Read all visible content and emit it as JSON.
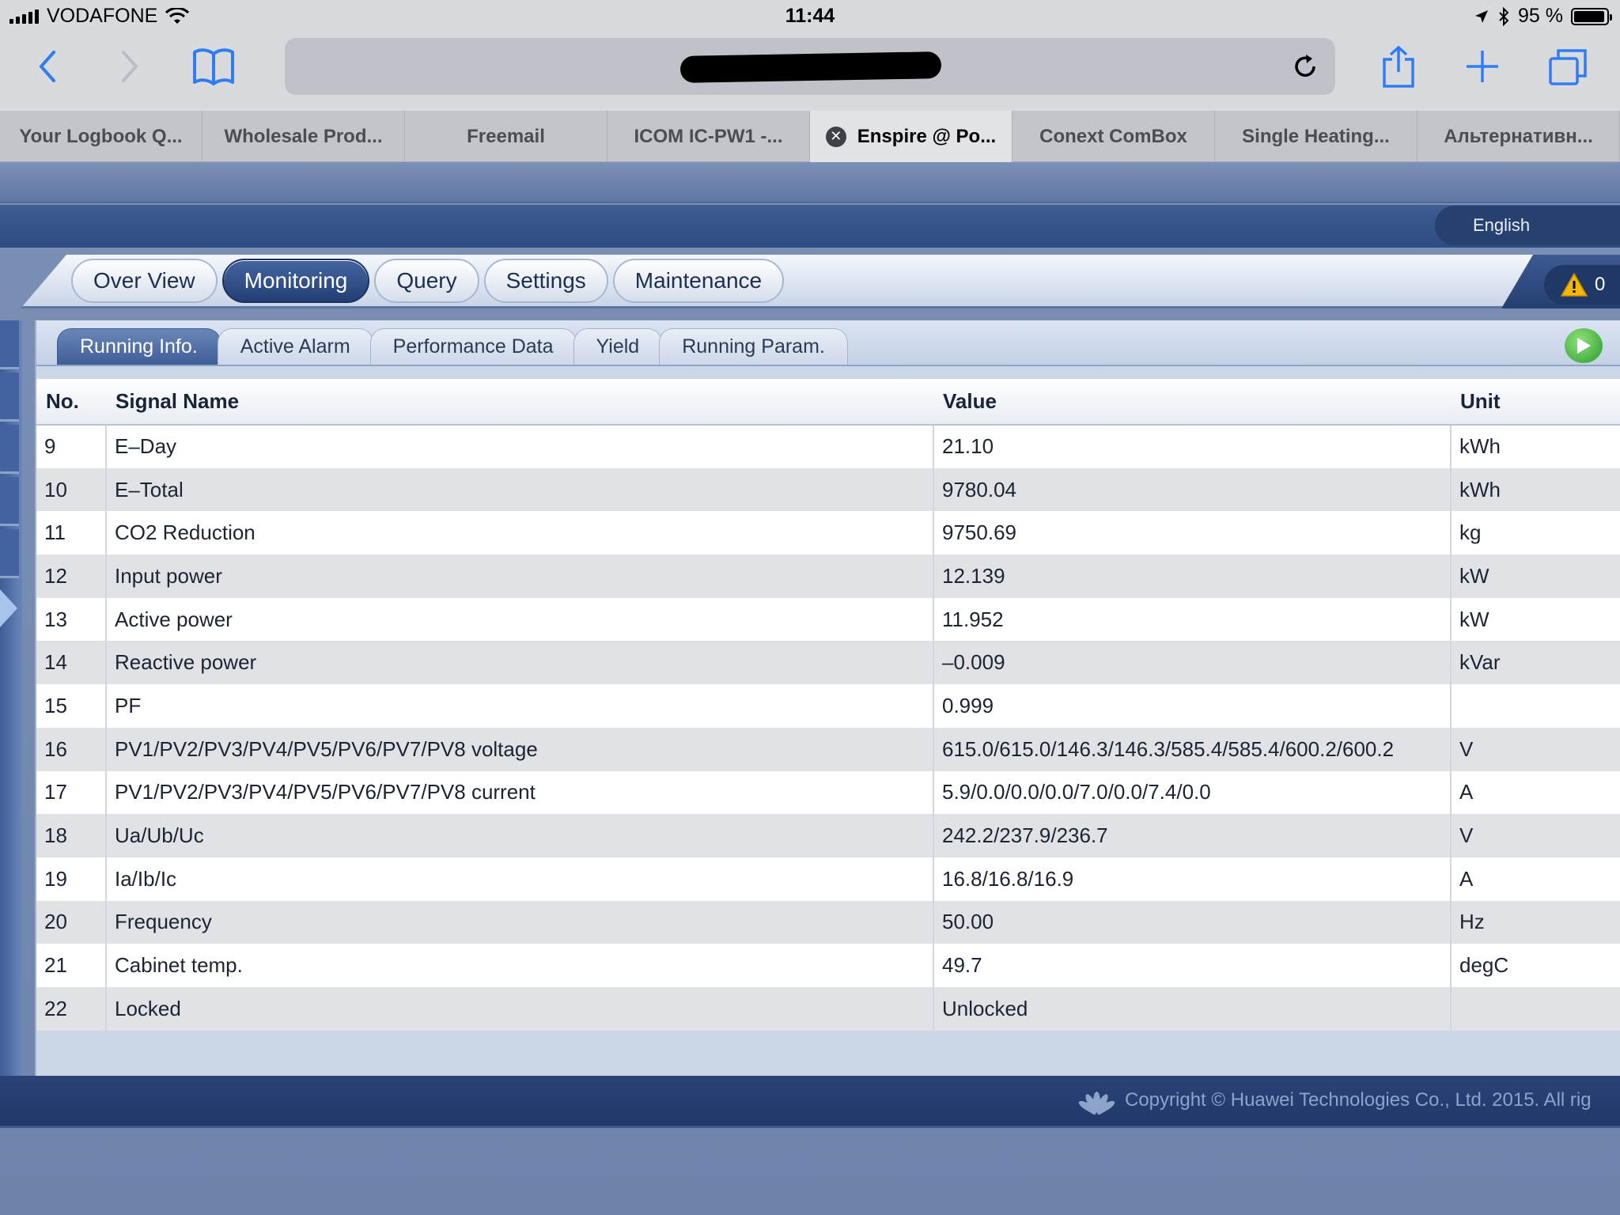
{
  "status_bar": {
    "carrier": "VODAFONE",
    "time": "11:44",
    "battery": "95 %",
    "battery_level": 0.95
  },
  "browser": {
    "tabs": [
      {
        "label": "Your Logbook Q...",
        "active": false
      },
      {
        "label": "Wholesale Prod...",
        "active": false
      },
      {
        "label": "Freemail",
        "active": false
      },
      {
        "label": "ICOM IC-PW1 -...",
        "active": false
      },
      {
        "label": "Enspire @ Po...",
        "active": true
      },
      {
        "label": "Conext ComBox",
        "active": false
      },
      {
        "label": "Single Heating...",
        "active": false
      },
      {
        "label": "Альтернативн...",
        "active": false
      }
    ]
  },
  "header": {
    "language": "English",
    "alarm_count": "0"
  },
  "nav": {
    "items": [
      "Over View",
      "Monitoring",
      "Query",
      "Settings",
      "Maintenance"
    ],
    "active": "Monitoring"
  },
  "subtabs": {
    "items": [
      "Running Info.",
      "Active Alarm",
      "Performance Data",
      "Yield",
      "Running Param."
    ],
    "active": "Running Info."
  },
  "table": {
    "headers": {
      "no": "No.",
      "name": "Signal Name",
      "value": "Value",
      "unit": "Unit"
    },
    "rows": [
      {
        "no": "9",
        "name": "E–Day",
        "value": "21.10",
        "unit": "kWh"
      },
      {
        "no": "10",
        "name": "E–Total",
        "value": "9780.04",
        "unit": "kWh"
      },
      {
        "no": "11",
        "name": "CO2 Reduction",
        "value": "9750.69",
        "unit": "kg"
      },
      {
        "no": "12",
        "name": "Input power",
        "value": "12.139",
        "unit": "kW"
      },
      {
        "no": "13",
        "name": "Active power",
        "value": "11.952",
        "unit": "kW"
      },
      {
        "no": "14",
        "name": "Reactive power",
        "value": "–0.009",
        "unit": "kVar"
      },
      {
        "no": "15",
        "name": "PF",
        "value": "0.999",
        "unit": ""
      },
      {
        "no": "16",
        "name": "PV1/PV2/PV3/PV4/PV5/PV6/PV7/PV8 voltage",
        "value": "615.0/615.0/146.3/146.3/585.4/585.4/600.2/600.2",
        "unit": "V"
      },
      {
        "no": "17",
        "name": "PV1/PV2/PV3/PV4/PV5/PV6/PV7/PV8 current",
        "value": "5.9/0.0/0.0/0.0/7.0/0.0/7.4/0.0",
        "unit": "A"
      },
      {
        "no": "18",
        "name": "Ua/Ub/Uc",
        "value": "242.2/237.9/236.7",
        "unit": "V"
      },
      {
        "no": "19",
        "name": "Ia/Ib/Ic",
        "value": "16.8/16.8/16.9",
        "unit": "A"
      },
      {
        "no": "20",
        "name": "Frequency",
        "value": "50.00",
        "unit": "Hz"
      },
      {
        "no": "21",
        "name": "Cabinet temp.",
        "value": "49.7",
        "unit": "degC"
      },
      {
        "no": "22",
        "name": "Locked",
        "value": "Unlocked",
        "unit": ""
      }
    ]
  },
  "footer": {
    "copyright": "Copyright © Huawei Technologies Co., Ltd. 2015. All rig"
  }
}
